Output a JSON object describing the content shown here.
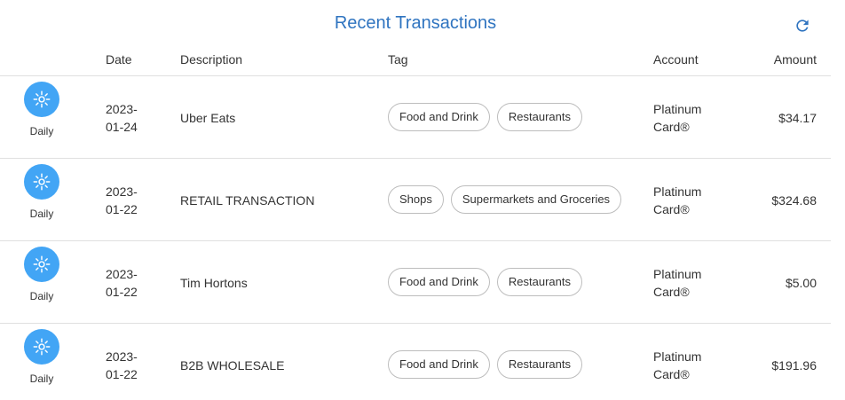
{
  "title": "Recent Transactions",
  "icons": {
    "refresh": "refresh-icon",
    "frequency": "sun-icon"
  },
  "colors": {
    "accent": "#2f74c0",
    "frequency_badge": "#42a5f5"
  },
  "columns": {
    "date": "Date",
    "description": "Description",
    "tag": "Tag",
    "account": "Account",
    "amount": "Amount"
  },
  "transactions": [
    {
      "frequency": "Daily",
      "date_year": "2023-",
      "date_md": "01-24",
      "description": "Uber Eats",
      "tags": [
        "Food and Drink",
        "Restaurants"
      ],
      "account_line1": "Platinum",
      "account_line2": "Card®",
      "amount": "$34.17"
    },
    {
      "frequency": "Daily",
      "date_year": "2023-",
      "date_md": "01-22",
      "description": "RETAIL TRANSACTION",
      "tags": [
        "Shops",
        "Supermarkets and Groceries"
      ],
      "account_line1": "Platinum",
      "account_line2": "Card®",
      "amount": "$324.68"
    },
    {
      "frequency": "Daily",
      "date_year": "2023-",
      "date_md": "01-22",
      "description": "Tim Hortons",
      "tags": [
        "Food and Drink",
        "Restaurants"
      ],
      "account_line1": "Platinum",
      "account_line2": "Card®",
      "amount": "$5.00"
    },
    {
      "frequency": "Daily",
      "date_year": "2023-",
      "date_md": "01-22",
      "description": "B2B WHOLESALE",
      "tags": [
        "Food and Drink",
        "Restaurants"
      ],
      "account_line1": "Platinum",
      "account_line2": "Card®",
      "amount": "$191.96"
    }
  ]
}
